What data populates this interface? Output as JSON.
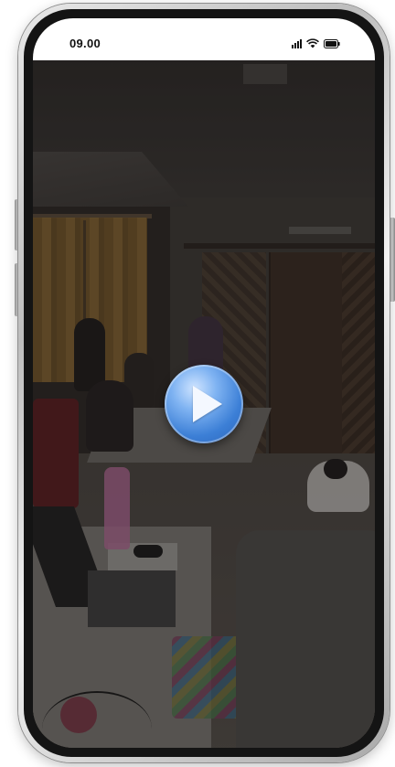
{
  "status_bar": {
    "time": "09.00",
    "signal_icon": "signal-icon",
    "wifi_icon": "wifi-icon",
    "battery_icon": "battery-icon"
  },
  "video": {
    "play_icon": "play-icon"
  },
  "colors": {
    "play_button": "#3c7fd6",
    "status_bar_bg": "#ffffff",
    "phone_frame": "#c4c4c4"
  }
}
